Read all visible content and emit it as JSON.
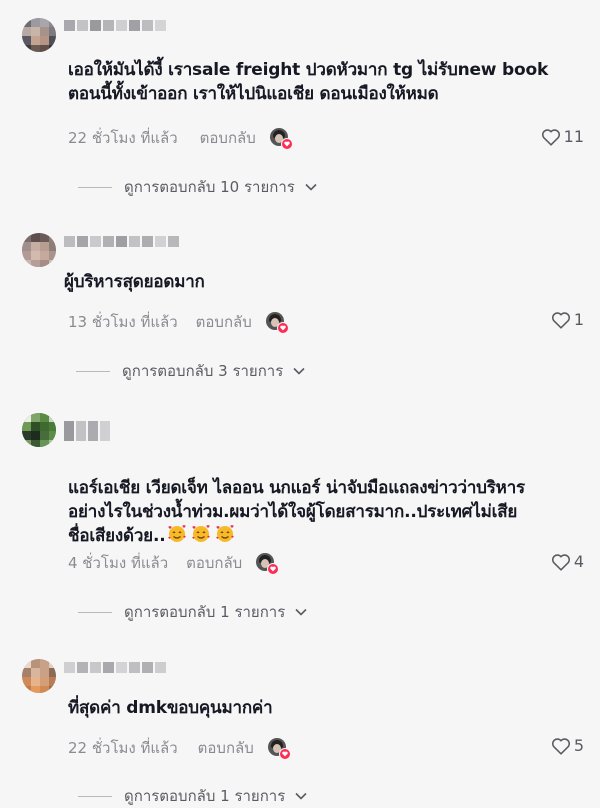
{
  "comments": [
    {
      "text": "เออให้มันได้งี้ เราsale freight ปวดหัวมาก tg ไม่รับnew book\nตอนนี้ทั้งเข้าออก เราให้ไปนิแอเชีย ดอนเมืองให้หมด",
      "time": "22 ชั่วโมง ที่แล้ว",
      "reply_label": "ตอบกลับ",
      "likes": "11",
      "view_replies": "ดูการตอบกลับ 10 รายการ"
    },
    {
      "text": "ผู้บริหารสุดยอดมาก",
      "time": "13 ชั่วโมง ที่แล้ว",
      "reply_label": "ตอบกลับ",
      "likes": "1",
      "view_replies": "ดูการตอบกลับ 3 รายการ"
    },
    {
      "text": "แอร์เอเชีย เวียดเจ็ท ไลออน นกแอร์ น่าจับมือแถลงข่าวว่าบริหาร\nอย่างไรในช่วงน้ำท่วม.ผมว่าได้ใจผู้โดยสารมาก..ประเทศไม่เสีย\nชื่อเสียงด้วย..",
      "emoji": "smiling-face-with-hearts",
      "time": "4 ชั่วโมง ที่แล้ว",
      "reply_label": "ตอบกลับ",
      "likes": "4",
      "view_replies": "ดูการตอบกลับ 1 รายการ"
    },
    {
      "text": "ที่สุดค่า dmkขอบคุนมากค่า",
      "time": "22 ชั่วโมง ที่แล้ว",
      "reply_label": "ตอบกลับ",
      "likes": "5",
      "view_replies": "ดูการตอบกลับ 1 รายการ"
    }
  ],
  "colors": {
    "background": "#f6f6f6",
    "text": "#161823",
    "muted": "#8a8b91",
    "creator_heart": "#fe2c55"
  },
  "icons": {
    "like": "heart-outline-icon",
    "expand": "chevron-down-icon",
    "creator_liked": "creator-liked-badge-icon"
  }
}
